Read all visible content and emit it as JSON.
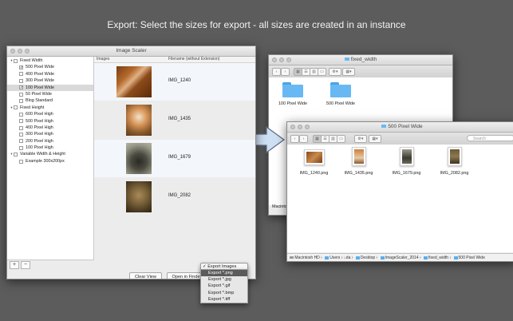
{
  "caption": "Export: Select the sizes for export - all sizes are created in an instance",
  "scaler": {
    "title": "Image Scaler",
    "col_images": "Images",
    "col_filename": "Filename (without Extension)",
    "tree": [
      {
        "label": "Fixed Width",
        "level": 0,
        "group": true,
        "checked": false
      },
      {
        "label": "500 Pixel Wide",
        "level": 1,
        "checked": true
      },
      {
        "label": "400 Pixel Wide",
        "level": 1,
        "checked": false
      },
      {
        "label": "300 Pixel Wide",
        "level": 1,
        "checked": false
      },
      {
        "label": "100 Pixel Wide",
        "level": 1,
        "checked": true,
        "selected": true
      },
      {
        "label": "50 Pixel Wide",
        "level": 1,
        "checked": false
      },
      {
        "label": "Blog Standard",
        "level": 1,
        "checked": false
      },
      {
        "label": "Fixed Height",
        "level": 0,
        "group": true,
        "checked": false
      },
      {
        "label": "600 Pixel High",
        "level": 1,
        "checked": false
      },
      {
        "label": "500 Pixel High",
        "level": 1,
        "checked": false
      },
      {
        "label": "400 Pixel High",
        "level": 1,
        "checked": false
      },
      {
        "label": "300 Pixel High",
        "level": 1,
        "checked": false
      },
      {
        "label": "200 Pixel High",
        "level": 1,
        "checked": false
      },
      {
        "label": "100 Pixel High",
        "level": 1,
        "checked": false
      },
      {
        "label": "Variable Width & Height",
        "level": 0,
        "group": true,
        "checked": false
      },
      {
        "label": "Example 300x200px",
        "level": 1,
        "checked": false
      }
    ],
    "add_symbol": "+",
    "remove_symbol": "−",
    "images": [
      {
        "name": "IMG_1240"
      },
      {
        "name": "IMG_1435"
      },
      {
        "name": "IMG_1679"
      },
      {
        "name": "IMG_2082"
      }
    ],
    "clear_view": "Clear View",
    "open_in_finder": "Open in Finder",
    "export_selected": "✓ Export Images",
    "export_options": [
      "Export *.png",
      "Export *.jpg",
      "Export *.gif",
      "Export *.bmp",
      "Export *.tiff"
    ],
    "export_highlighted": "Export *.png"
  },
  "finder1": {
    "title": "fixed_width",
    "folders": [
      "100 Pixel Wide",
      "500 Pixel Wide"
    ],
    "sidebar_label": "Macintosh"
  },
  "finder2": {
    "title": "500 Pixel Wide",
    "search_placeholder": "Search",
    "files": [
      "IMG_1240.png",
      "IMG_1435.png",
      "IMG_1679.png",
      "IMG_2082.png"
    ],
    "path": [
      "Macintosh HD",
      "Users",
      "da",
      "Desktop",
      "ImageScaler_2014",
      "fixed_width",
      "500 Pixel Wide"
    ]
  },
  "colors": {
    "folder": "#68b9f3",
    "highlight": "#2f72d2",
    "arrow": "#cfe0f5"
  }
}
